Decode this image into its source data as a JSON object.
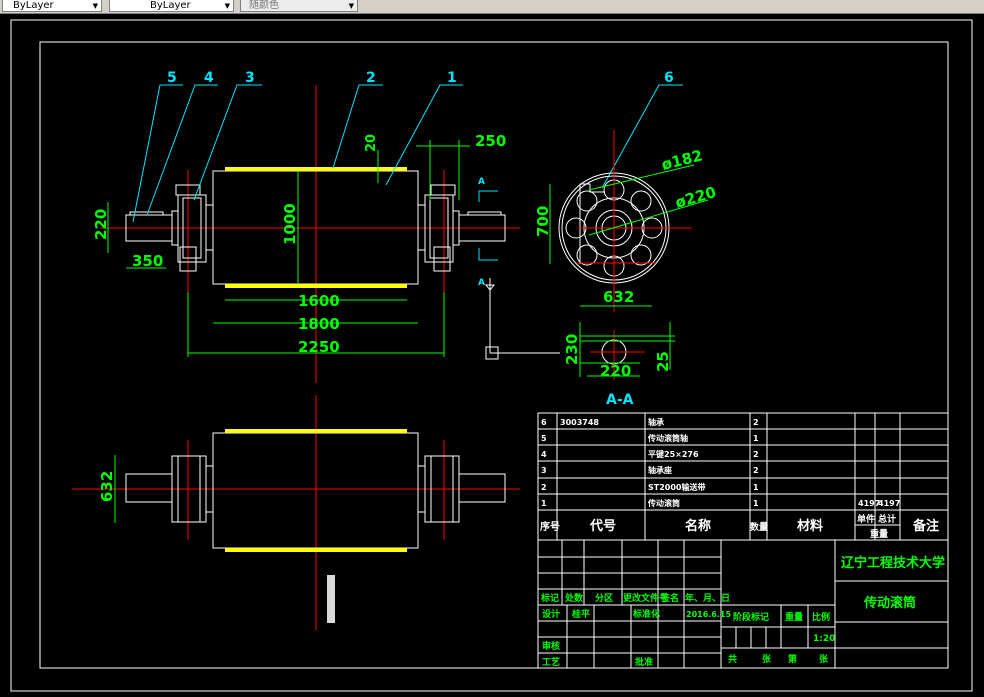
{
  "toolbar": {
    "linetype": "ByLayer",
    "lineweight": "ByLayer",
    "color": "随颜色"
  },
  "colors": {
    "background": "#000000",
    "outline": "#ffffff",
    "dimension": "#00ff00",
    "centerline": "#ff0000",
    "leader": "#00e5ff",
    "belt": "#ffff00"
  },
  "drawing": {
    "balloons": [
      "1",
      "2",
      "3",
      "4",
      "5",
      "6"
    ],
    "dims": {
      "d250": "250",
      "d20": "20",
      "d220": "220",
      "d350": "350",
      "d1000": "1000",
      "d1600": "1600",
      "d1800": "1800",
      "d2250": "2250",
      "d632": "632",
      "d700": "700",
      "phi182": "ø182",
      "phi220": "ø220",
      "d632b": "632",
      "d230": "230",
      "d220b": "220",
      "d25": "25"
    },
    "section_label": "A-A",
    "section_mark": "A"
  },
  "parts": {
    "rows": [
      {
        "no": "6",
        "code": "3003748",
        "name": "轴承",
        "qty": "2",
        "material": "",
        "unit": "",
        "total": "",
        "note": ""
      },
      {
        "no": "5",
        "code": "",
        "name": "传动滚筒轴",
        "qty": "1",
        "material": "",
        "unit": "",
        "total": "",
        "note": ""
      },
      {
        "no": "4",
        "code": "",
        "name": "平键25×276",
        "qty": "2",
        "material": "",
        "unit": "",
        "total": "",
        "note": ""
      },
      {
        "no": "3",
        "code": "",
        "name": "轴承座",
        "qty": "2",
        "material": "",
        "unit": "",
        "total": "",
        "note": ""
      },
      {
        "no": "2",
        "code": "",
        "name": "ST2000输送带",
        "qty": "1",
        "material": "",
        "unit": "",
        "total": "",
        "note": ""
      },
      {
        "no": "1",
        "code": "",
        "name": "传动滚筒",
        "qty": "1",
        "material": "",
        "unit": "4197",
        "total": "4197",
        "note": ""
      }
    ],
    "header": {
      "no": "序号",
      "code": "代号",
      "name": "名称",
      "qty": "数量",
      "material": "材料",
      "unit": "单件",
      "total": "总计",
      "weight": "重量",
      "note": "备注"
    }
  },
  "title_block": {
    "mark": "标记",
    "count": "处数",
    "zone": "分区",
    "change_doc": "更改文件号",
    "sign": "签名",
    "date_label": "年、月、日",
    "design": "设计",
    "designer": "桂平",
    "standard": "标准化",
    "date": "2016.6.15",
    "review": "审核",
    "process": "工艺",
    "approve": "批准",
    "stage": "阶段标记",
    "weight": "重量",
    "scale": "比例",
    "scale_value": "1:20",
    "sheets_total": "共",
    "sheets_unit": "张",
    "sheet_no": "第",
    "sheet_unit2": "张",
    "school": "辽宁工程技术大学",
    "drawing_title": "传动滚筒"
  }
}
